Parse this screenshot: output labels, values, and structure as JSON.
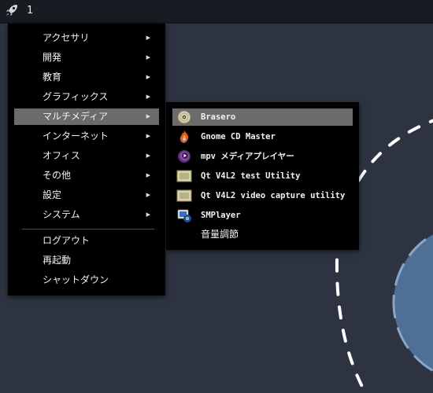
{
  "topbar": {
    "launcher_icon": "rocket-icon",
    "workspace": "1"
  },
  "main_menu": {
    "categories": [
      {
        "label": "アクセサリ",
        "arrow": "▶"
      },
      {
        "label": "開発",
        "arrow": "▶"
      },
      {
        "label": "教育",
        "arrow": "▶"
      },
      {
        "label": "グラフィックス",
        "arrow": "▶"
      },
      {
        "label": "マルチメディア",
        "arrow": "▶"
      },
      {
        "label": "インターネット",
        "arrow": "▶"
      },
      {
        "label": "オフィス",
        "arrow": "▶"
      },
      {
        "label": "その他",
        "arrow": "▶"
      },
      {
        "label": "設定",
        "arrow": "▶"
      },
      {
        "label": "システム",
        "arrow": "▶"
      }
    ],
    "session": [
      {
        "label": "ログアウト"
      },
      {
        "label": "再起動"
      },
      {
        "label": "シャットダウン"
      }
    ]
  },
  "submenu": {
    "items": [
      {
        "label": "Brasero",
        "icon": "disc-burner-icon"
      },
      {
        "label": "Gnome CD Master",
        "icon": "flame-disc-icon"
      },
      {
        "label": "mpv メディアプレイヤー",
        "icon": "mpv-icon"
      },
      {
        "label": "Qt V4L2 test Utility",
        "icon": "webcam-icon"
      },
      {
        "label": "Qt V4L2 video capture utility",
        "icon": "webcam-icon"
      },
      {
        "label": "SMPlayer",
        "icon": "smplayer-icon"
      },
      {
        "label": "音量調節",
        "icon": ""
      }
    ]
  },
  "colors": {
    "desktop": "#2d3340",
    "menu_bg": "#000000",
    "highlight": "#6b6b6b",
    "globe": "#4f6f95"
  }
}
